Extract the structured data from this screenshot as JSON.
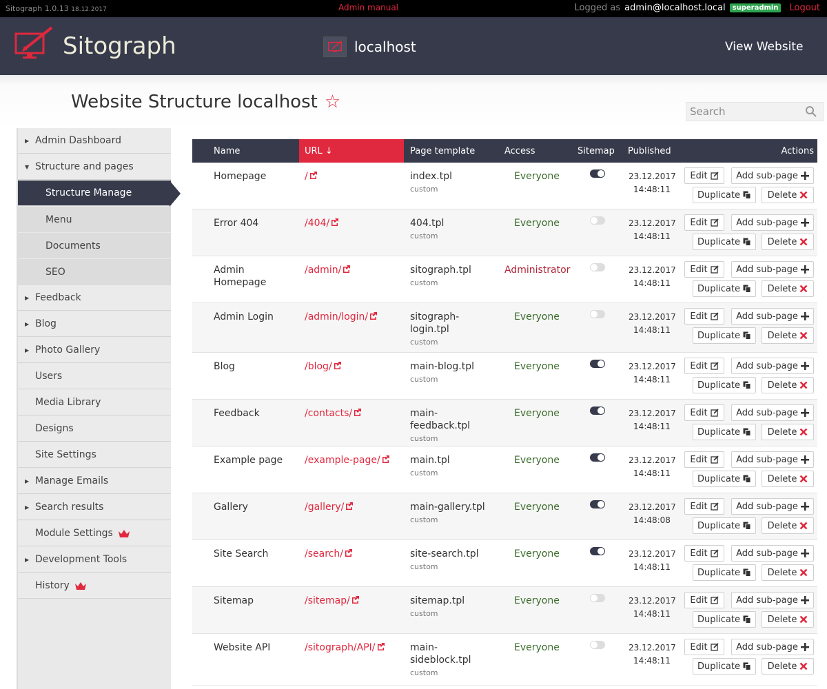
{
  "topbar": {
    "app_version": "Sitograph 1.0.13",
    "build_date": "18.12.2017",
    "admin_manual": "Admin manual",
    "logged_as_label": "Logged as",
    "user": "admin@localhost.local",
    "role_badge": "superadmin",
    "logout": "Logout"
  },
  "header": {
    "brand": "Sitograph",
    "site_name": "localhost",
    "view_website": "View Website"
  },
  "page": {
    "title": "Website Structure localhost",
    "search_placeholder": "Search"
  },
  "sidebar": {
    "items": [
      {
        "label": "Admin Dashboard",
        "arrow": "right"
      },
      {
        "label": "Structure and pages",
        "arrow": "down"
      },
      {
        "label": "Structure Manage",
        "active": true
      },
      {
        "label": "Menu",
        "sub": true
      },
      {
        "label": "Documents",
        "sub": true
      },
      {
        "label": "SEO",
        "sub": true
      },
      {
        "label": "Feedback",
        "arrow": "right"
      },
      {
        "label": "Blog",
        "arrow": "right"
      },
      {
        "label": "Photo Gallery",
        "arrow": "right"
      },
      {
        "label": "Users"
      },
      {
        "label": "Media Library"
      },
      {
        "label": "Designs"
      },
      {
        "label": "Site Settings"
      },
      {
        "label": "Manage Emails",
        "arrow": "right"
      },
      {
        "label": "Search results",
        "arrow": "right"
      },
      {
        "label": "Module Settings",
        "crown": true
      },
      {
        "label": "Development Tools",
        "arrow": "right"
      },
      {
        "label": "History",
        "crown": true
      }
    ]
  },
  "table": {
    "headers": {
      "name": "Name",
      "url": "URL ↓",
      "template": "Page template",
      "access": "Access",
      "sitemap": "Sitemap",
      "published": "Published",
      "actions": "Actions"
    },
    "buttons": {
      "edit": "Edit",
      "add_sub": "Add sub-page",
      "duplicate": "Duplicate",
      "delete": "Delete"
    },
    "rows": [
      {
        "name": "Homepage",
        "url": "/",
        "template": "index.tpl",
        "source": "custom",
        "access": "Everyone",
        "sitemap": true,
        "date": "23.12.2017",
        "time": "14:48:11"
      },
      {
        "name": "Error 404",
        "url": "/404/",
        "template": "404.tpl",
        "source": "custom",
        "access": "Everyone",
        "sitemap": false,
        "date": "23.12.2017",
        "time": "14:48:11"
      },
      {
        "name": "Admin Homepage",
        "url": "/admin/",
        "template": "sitograph.tpl",
        "source": "custom",
        "access": "Administrator",
        "sitemap": false,
        "date": "23.12.2017",
        "time": "14:48:11"
      },
      {
        "name": "Admin Login",
        "url": "/admin/login/",
        "template": "sitograph-login.tpl",
        "source": "custom",
        "access": "Everyone",
        "sitemap": false,
        "date": "23.12.2017",
        "time": "14:48:11"
      },
      {
        "name": "Blog",
        "url": "/blog/",
        "template": "main-blog.tpl",
        "source": "custom",
        "access": "Everyone",
        "sitemap": true,
        "date": "23.12.2017",
        "time": "14:48:11"
      },
      {
        "name": "Feedback",
        "url": "/contacts/",
        "template": "main-feedback.tpl",
        "source": "custom",
        "access": "Everyone",
        "sitemap": true,
        "date": "23.12.2017",
        "time": "14:48:11"
      },
      {
        "name": "Example page",
        "url": "/example-page/",
        "template": "main.tpl",
        "source": "custom",
        "access": "Everyone",
        "sitemap": true,
        "date": "23.12.2017",
        "time": "14:48:11"
      },
      {
        "name": "Gallery",
        "url": "/gallery/",
        "template": "main-gallery.tpl",
        "source": "custom",
        "access": "Everyone",
        "sitemap": true,
        "date": "23.12.2017",
        "time": "14:48:08"
      },
      {
        "name": "Site Search",
        "url": "/search/",
        "template": "site-search.tpl",
        "source": "custom",
        "access": "Everyone",
        "sitemap": true,
        "date": "23.12.2017",
        "time": "14:48:11"
      },
      {
        "name": "Sitemap",
        "url": "/sitemap/",
        "template": "sitemap.tpl",
        "source": "custom",
        "access": "Everyone",
        "sitemap": false,
        "date": "23.12.2017",
        "time": "14:48:11"
      },
      {
        "name": "Website API",
        "url": "/sitograph/API/",
        "template": "main-sideblock.tpl",
        "source": "custom",
        "access": "Everyone",
        "sitemap": false,
        "date": "23.12.2017",
        "time": "14:48:11"
      }
    ]
  },
  "colors": {
    "accent": "#e0283e",
    "dark": "#363a4b",
    "access_ok": "#3a6b2b",
    "access_admin": "#b1283a",
    "badge": "#2ea44f"
  }
}
